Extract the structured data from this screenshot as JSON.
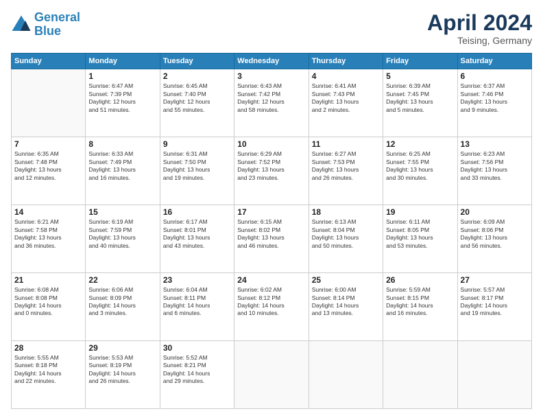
{
  "logo": {
    "line1": "General",
    "line2": "Blue"
  },
  "header": {
    "month": "April 2024",
    "location": "Teising, Germany"
  },
  "days_of_week": [
    "Sunday",
    "Monday",
    "Tuesday",
    "Wednesday",
    "Thursday",
    "Friday",
    "Saturday"
  ],
  "weeks": [
    [
      {
        "day": "",
        "text": ""
      },
      {
        "day": "1",
        "text": "Sunrise: 6:47 AM\nSunset: 7:39 PM\nDaylight: 12 hours\nand 51 minutes."
      },
      {
        "day": "2",
        "text": "Sunrise: 6:45 AM\nSunset: 7:40 PM\nDaylight: 12 hours\nand 55 minutes."
      },
      {
        "day": "3",
        "text": "Sunrise: 6:43 AM\nSunset: 7:42 PM\nDaylight: 12 hours\nand 58 minutes."
      },
      {
        "day": "4",
        "text": "Sunrise: 6:41 AM\nSunset: 7:43 PM\nDaylight: 13 hours\nand 2 minutes."
      },
      {
        "day": "5",
        "text": "Sunrise: 6:39 AM\nSunset: 7:45 PM\nDaylight: 13 hours\nand 5 minutes."
      },
      {
        "day": "6",
        "text": "Sunrise: 6:37 AM\nSunset: 7:46 PM\nDaylight: 13 hours\nand 9 minutes."
      }
    ],
    [
      {
        "day": "7",
        "text": "Sunrise: 6:35 AM\nSunset: 7:48 PM\nDaylight: 13 hours\nand 12 minutes."
      },
      {
        "day": "8",
        "text": "Sunrise: 6:33 AM\nSunset: 7:49 PM\nDaylight: 13 hours\nand 16 minutes."
      },
      {
        "day": "9",
        "text": "Sunrise: 6:31 AM\nSunset: 7:50 PM\nDaylight: 13 hours\nand 19 minutes."
      },
      {
        "day": "10",
        "text": "Sunrise: 6:29 AM\nSunset: 7:52 PM\nDaylight: 13 hours\nand 23 minutes."
      },
      {
        "day": "11",
        "text": "Sunrise: 6:27 AM\nSunset: 7:53 PM\nDaylight: 13 hours\nand 26 minutes."
      },
      {
        "day": "12",
        "text": "Sunrise: 6:25 AM\nSunset: 7:55 PM\nDaylight: 13 hours\nand 30 minutes."
      },
      {
        "day": "13",
        "text": "Sunrise: 6:23 AM\nSunset: 7:56 PM\nDaylight: 13 hours\nand 33 minutes."
      }
    ],
    [
      {
        "day": "14",
        "text": "Sunrise: 6:21 AM\nSunset: 7:58 PM\nDaylight: 13 hours\nand 36 minutes."
      },
      {
        "day": "15",
        "text": "Sunrise: 6:19 AM\nSunset: 7:59 PM\nDaylight: 13 hours\nand 40 minutes."
      },
      {
        "day": "16",
        "text": "Sunrise: 6:17 AM\nSunset: 8:01 PM\nDaylight: 13 hours\nand 43 minutes."
      },
      {
        "day": "17",
        "text": "Sunrise: 6:15 AM\nSunset: 8:02 PM\nDaylight: 13 hours\nand 46 minutes."
      },
      {
        "day": "18",
        "text": "Sunrise: 6:13 AM\nSunset: 8:04 PM\nDaylight: 13 hours\nand 50 minutes."
      },
      {
        "day": "19",
        "text": "Sunrise: 6:11 AM\nSunset: 8:05 PM\nDaylight: 13 hours\nand 53 minutes."
      },
      {
        "day": "20",
        "text": "Sunrise: 6:09 AM\nSunset: 8:06 PM\nDaylight: 13 hours\nand 56 minutes."
      }
    ],
    [
      {
        "day": "21",
        "text": "Sunrise: 6:08 AM\nSunset: 8:08 PM\nDaylight: 14 hours\nand 0 minutes."
      },
      {
        "day": "22",
        "text": "Sunrise: 6:06 AM\nSunset: 8:09 PM\nDaylight: 14 hours\nand 3 minutes."
      },
      {
        "day": "23",
        "text": "Sunrise: 6:04 AM\nSunset: 8:11 PM\nDaylight: 14 hours\nand 6 minutes."
      },
      {
        "day": "24",
        "text": "Sunrise: 6:02 AM\nSunset: 8:12 PM\nDaylight: 14 hours\nand 10 minutes."
      },
      {
        "day": "25",
        "text": "Sunrise: 6:00 AM\nSunset: 8:14 PM\nDaylight: 14 hours\nand 13 minutes."
      },
      {
        "day": "26",
        "text": "Sunrise: 5:59 AM\nSunset: 8:15 PM\nDaylight: 14 hours\nand 16 minutes."
      },
      {
        "day": "27",
        "text": "Sunrise: 5:57 AM\nSunset: 8:17 PM\nDaylight: 14 hours\nand 19 minutes."
      }
    ],
    [
      {
        "day": "28",
        "text": "Sunrise: 5:55 AM\nSunset: 8:18 PM\nDaylight: 14 hours\nand 22 minutes."
      },
      {
        "day": "29",
        "text": "Sunrise: 5:53 AM\nSunset: 8:19 PM\nDaylight: 14 hours\nand 26 minutes."
      },
      {
        "day": "30",
        "text": "Sunrise: 5:52 AM\nSunset: 8:21 PM\nDaylight: 14 hours\nand 29 minutes."
      },
      {
        "day": "",
        "text": ""
      },
      {
        "day": "",
        "text": ""
      },
      {
        "day": "",
        "text": ""
      },
      {
        "day": "",
        "text": ""
      }
    ]
  ]
}
